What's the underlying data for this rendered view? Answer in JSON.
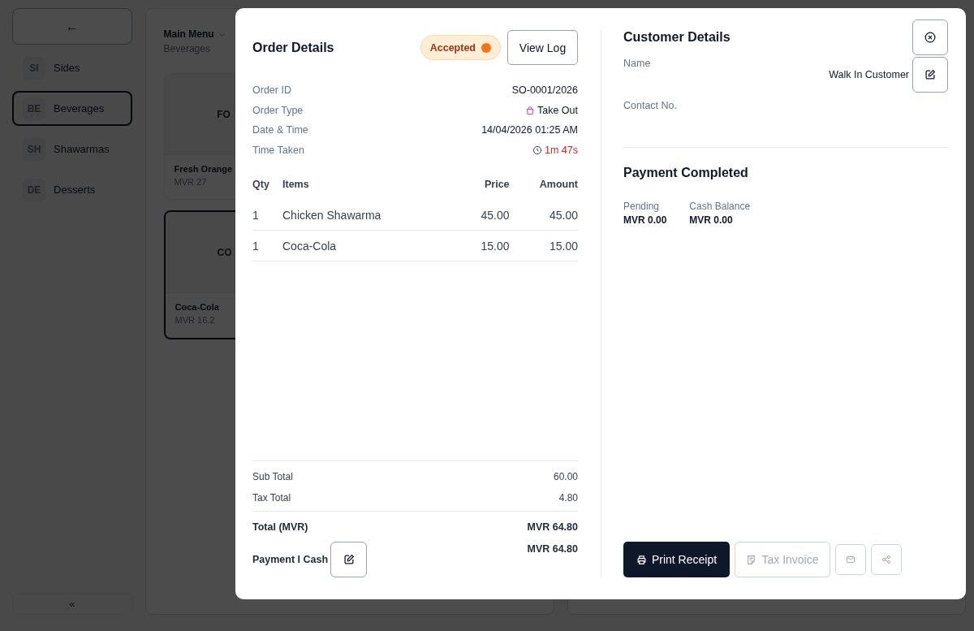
{
  "background": {
    "back_button": "←",
    "categories": [
      {
        "code": "SI",
        "label": "Sides",
        "selected": false
      },
      {
        "code": "BE",
        "label": "Beverages",
        "selected": true
      },
      {
        "code": "SH",
        "label": "Shawarmas",
        "selected": false
      },
      {
        "code": "DE",
        "label": "Desserts",
        "selected": false
      }
    ],
    "collapse_button": "«",
    "menu": {
      "title": "Main Menu",
      "subtitle": "Beverages"
    },
    "products": [
      {
        "placeholder": "FO",
        "name": "Fresh Orange",
        "price": "MVR 27",
        "selected": false
      },
      {
        "placeholder": "CO",
        "name": "Coca-Cola",
        "price": "MVR 16.2",
        "selected": true
      }
    ]
  },
  "order": {
    "title": "Order Details",
    "status": "Accepted",
    "view_log": "View Log",
    "fields": [
      {
        "label": "Order ID",
        "value": "SO-0001/2026",
        "kind": "plain"
      },
      {
        "label": "Order Type",
        "value": "Take Out",
        "kind": "order-type"
      },
      {
        "label": "Date & Time",
        "value": "14/04/2026 01:25 AM",
        "kind": "plain"
      },
      {
        "label": "Time Taken",
        "value": "1m 47s",
        "kind": "timer"
      }
    ],
    "columns": [
      "Qty",
      "Items",
      "Price",
      "Amount"
    ],
    "rows": [
      [
        "1",
        "Chicken Shawarma",
        "45.00",
        "45.00"
      ],
      [
        "1",
        "Coca-Cola",
        "15.00",
        "15.00"
      ]
    ],
    "totals": [
      {
        "label": "Sub Total",
        "value": "60.00",
        "kind": "line"
      },
      {
        "label": "Tax Total",
        "value": "4.80",
        "kind": "line"
      },
      {
        "label": "Total (MVR)",
        "value": "MVR 64.80",
        "kind": "grand"
      }
    ],
    "payment": {
      "label": "Payment I Cash",
      "value": "MVR 64.80"
    }
  },
  "customer": {
    "title": "Customer Details",
    "name_label": "Name",
    "name_value": "Walk In Customer",
    "contact_label": "Contact No."
  },
  "payment_status": {
    "title": "Payment Completed",
    "balances": [
      {
        "label": "Pending",
        "value": "MVR 0.00"
      },
      {
        "label": "Cash Balance",
        "value": "MVR 0.00"
      }
    ]
  },
  "actions": [
    {
      "kind": "print",
      "label": "Print Receipt",
      "disabled": false
    },
    {
      "kind": "invoice",
      "label": "Tax Invoice",
      "disabled": true
    },
    {
      "kind": "email",
      "disabled": true
    },
    {
      "kind": "share",
      "disabled": true
    }
  ]
}
